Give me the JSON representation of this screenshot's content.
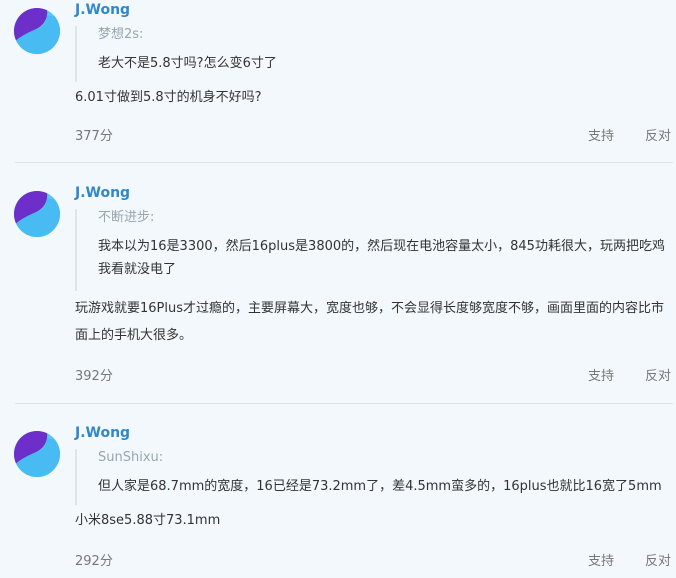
{
  "comments": [
    {
      "username": "J.Wong",
      "quote_author": "梦想2s:",
      "quote_text": "老大不是5.8寸吗?怎么变6寸了",
      "reply": "6.01寸做到5.8寸的机身不好吗?",
      "score": "377分",
      "support_label": "支持",
      "oppose_label": "反对"
    },
    {
      "username": "J.Wong",
      "quote_author": "不断进步:",
      "quote_text": "我本以为16是3300，然后16plus是3800的，然后现在电池容量太小，845功耗很大，玩两把吃鸡我看就没电了",
      "reply": "玩游戏就要16Plus才过瘾的，主要屏幕大，宽度也够，不会显得长度够宽度不够，画面里面的内容比市面上的手机大很多。",
      "score": "392分",
      "support_label": "支持",
      "oppose_label": "反对"
    },
    {
      "username": "J.Wong",
      "quote_author": "SunShixu:",
      "quote_text": "但人家是68.7mm的宽度，16已经是73.2mm了，差4.5mm蛮多的，16plus也就比16宽了5mm",
      "reply": "小米8se5.88寸73.1mm",
      "score": "292分",
      "support_label": "支持",
      "oppose_label": "反对"
    }
  ],
  "colors": {
    "background": "#f3f8fc",
    "username": "#2f88c8",
    "avatar_light": "#55c7f7",
    "avatar_dark": "#7b2fd0"
  },
  "icons": [
    "user-avatar-icon"
  ]
}
